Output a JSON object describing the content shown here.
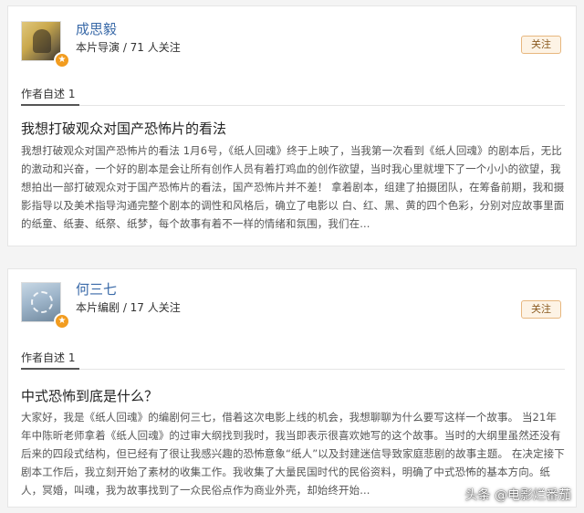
{
  "reviews": [
    {
      "author": "成思毅",
      "role": "本片导演 / 71 人关注",
      "follow_label": "关注",
      "section_label": "作者自述 1",
      "title": "我想打破观众对国产恐怖片的看法",
      "excerpt": "我想打破观众对国产恐怖片的看法 1月6号，《纸人回魂》终于上映了，当我第一次看到《纸人回魂》的剧本后，无比的激动和兴奋，一个好的剧本是会让所有创作人员有着打鸡血的创作欲望，当时我心里就埋下了一个小小的欲望，我想拍出一部打破观众对于国产恐怖片的看法，国产恐怖片并不差！ 拿着剧本，组建了拍摄团队，在筹备前期，我和摄影指导以及美术指导沟通完整个剧本的调性和风格后，确立了电影以 白、红、黑、黄的四个色彩，分别对应故事里面的纸童、纸妻、纸祭、纸梦，每个故事有着不一样的情绪和氛围，我们在..."
    },
    {
      "author": "何三七",
      "role": "本片编剧 / 17 人关注",
      "follow_label": "关注",
      "section_label": "作者自述 1",
      "title": "中式恐怖到底是什么？",
      "excerpt": "大家好，我是《纸人回魂》的编剧何三七，借着这次电影上线的机会，我想聊聊为什么要写这样一个故事。 当21年年中陈昕老师拿着《纸人回魂》的过审大纲找到我时，我当即表示很喜欢她写的这个故事。当时的大纲里虽然还没有后来的四段式结构，但已经有了很让我感兴趣的恐怖意象“纸人”以及封建迷信导致家庭悲剧的故事主题。 在决定接下剧本工作后，我立刻开始了素材的收集工作。我收集了大量民国时代的民俗资料，明确了中式恐怖的基本方向。纸人，冥婚，叫魂，我为故事找到了一众民俗点作为商业外壳，却始终开始..."
    }
  ],
  "watermark": "头条 @电影烂番茄"
}
